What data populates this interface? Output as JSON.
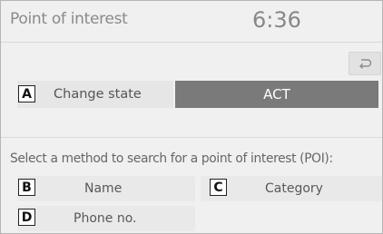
{
  "header": {
    "title": "Point of interest",
    "clock": "6:36"
  },
  "nav": {
    "back_icon": "back-arrow-icon"
  },
  "change_state": {
    "badge": "A",
    "label": "Change state",
    "value": "ACT"
  },
  "search": {
    "prompt": "Select a method to search for a point of interest (POI):",
    "options": [
      {
        "badge": "B",
        "label": "Name"
      },
      {
        "badge": "C",
        "label": "Category"
      },
      {
        "badge": "D",
        "label": "Phone no."
      }
    ]
  },
  "colors": {
    "active_button": "#7a7a7a",
    "screen_background": "#f0f0f0",
    "button_background": "#e9e9e9"
  }
}
